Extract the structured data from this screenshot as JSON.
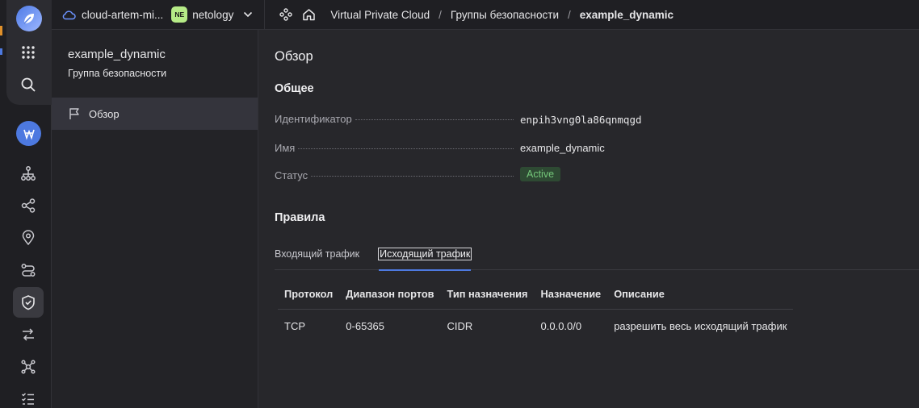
{
  "topbar": {
    "cloud_name": "cloud-artem-mi...",
    "folder_badge": "NE",
    "folder_name": "netology",
    "breadcrumbs": [
      "Virtual Private Cloud",
      "Группы безопасности",
      "example_dynamic"
    ]
  },
  "sidebar": {
    "title": "example_dynamic",
    "subtitle": "Группа безопасности",
    "items": [
      {
        "label": "Обзор"
      }
    ]
  },
  "main": {
    "title": "Обзор",
    "general_title": "Общее",
    "fields": [
      {
        "label": "Идентификатор",
        "value": "enpih3vng0la86qnmqgd"
      },
      {
        "label": "Имя",
        "value": "example_dynamic"
      },
      {
        "label": "Статус",
        "value": "Active"
      }
    ],
    "rules_title": "Правила",
    "tabs": [
      {
        "label": "Входящий трафик"
      },
      {
        "label": "Исходящий трафик"
      }
    ],
    "table": {
      "headers": [
        "Протокол",
        "Диапазон портов",
        "Тип назначения",
        "Назначение",
        "Описание"
      ],
      "rows": [
        [
          "TCP",
          "0-65365",
          "CIDR",
          "0.0.0.0/0",
          "разрешить весь исходящий трафик"
        ]
      ]
    }
  },
  "colors": {
    "accent": "#4d79e0",
    "status_bg": "#2e4a33",
    "status_fg": "#74c77a",
    "badge_bg": "#b6eb87"
  }
}
